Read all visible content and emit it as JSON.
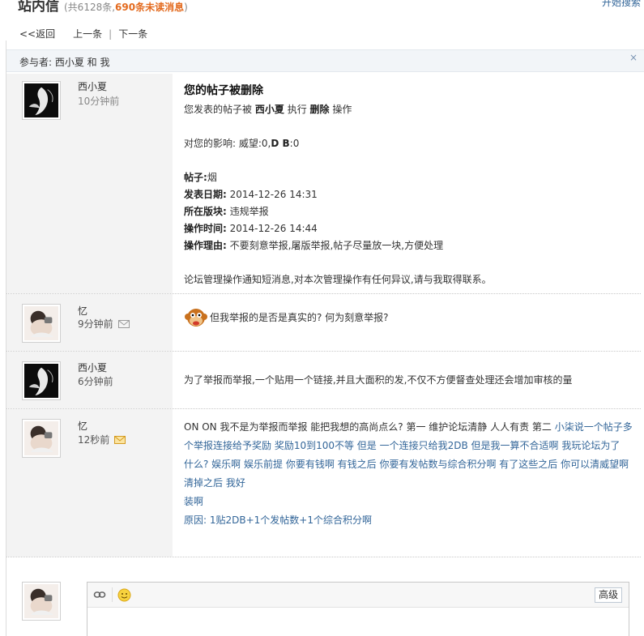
{
  "header": {
    "title": "站内信",
    "count_prefix": "(共6128条,",
    "unread": "690条未读消息",
    "count_suffix": ")",
    "right_link": "开始搜索"
  },
  "nav": {
    "back": "<<返回",
    "prev": "上一条",
    "separator": "|",
    "next": "下一条"
  },
  "participants": {
    "text": "参与者: 西小夏 和 我",
    "close": "×"
  },
  "messages": [
    {
      "name": "西小夏",
      "time": "10分钟前",
      "subject": "您的帖子被删除",
      "line1_a": "您发表的帖子被",
      "line1_user": "西小夏",
      "line1_b": "执行",
      "line1_action": "删除",
      "line1_c": "操作",
      "impact": "对您的影响: 威望:0,",
      "impact_db": "D B",
      "impact_end": ":0",
      "post_label": "帖子:",
      "post_value": "烟",
      "date_label": "发表日期:",
      "date_value": "2014-12-26 14:31",
      "board_label": "所在版块:",
      "board_value": "违规举报",
      "optime_label": "操作时间:",
      "optime_value": "2014-12-26 14:44",
      "reason_label": "操作理由:",
      "reason_value": "不要刻意举报,屠版举报,帖子尽量放一块,方便处理",
      "footer": "论坛管理操作通知短消息,对本次管理操作有任何异议,请与我取得联系。"
    },
    {
      "name": "忆",
      "time": "9分钟前",
      "text": "但我举报的是否是真实的? 何为刻意举报?"
    },
    {
      "name": "西小夏",
      "time": "6分钟前",
      "text": "为了举报而举报,一个贴用一个链接,并且大面积的发,不仅不方便督查处理还会增加审核的量"
    },
    {
      "name": "忆",
      "time": "12秒前",
      "line1_dark": "ON ON 我不是为举报而举报 能把我想的高尚点么? 第一 维护论坛清静 人人有责 第二",
      "line1_blue": "小柒说一个帖子多个举报连接给予奖励 奖励10到100不等 但是 一个连接只给我2DB 但是我一算不合适啊 我玩论坛为了",
      "line2": "什么? 娱乐啊 娱乐前提 你要有钱啊 有钱之后 你要有发帖数与综合积分啊 有了这些之后 你可以清威望啊   清掉之后 我好",
      "line3": "装啊",
      "line4": "原因: 1贴2DB+1个发帖数+1个综合积分啊"
    }
  ],
  "reply": {
    "advanced": "高级"
  },
  "colors": {
    "unread": "#e36a1e",
    "link": "#336699",
    "side_bg": "#f3f3f3",
    "bar_bg": "#f2f5f8"
  }
}
